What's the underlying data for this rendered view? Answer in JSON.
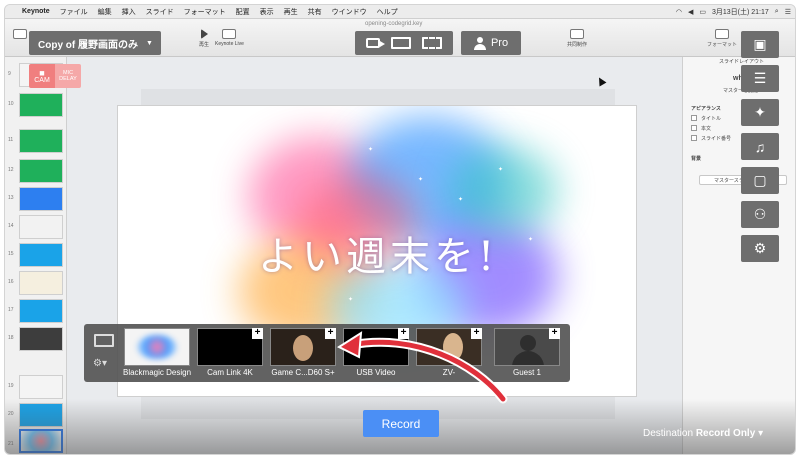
{
  "menubar": {
    "app_name": "Keynote",
    "items": [
      "ファイル",
      "編集",
      "挿入",
      "スライド",
      "フォーマット",
      "配置",
      "表示",
      "再生",
      "共有",
      "ウインドウ",
      "ヘルプ"
    ],
    "date_time": "3月13日(土)  21:17"
  },
  "toolbar": {
    "document_name": "opening-codegrid.key",
    "play_label": "再生",
    "keynote_live_label": "Keynote Live",
    "collaborate_label": "共同制作",
    "format_label": "フォーマット",
    "document_tab_label": "書類"
  },
  "overlay": {
    "presentation_chip": "Copy of 履野画面のみ",
    "cam_label": "CAM",
    "mic_label_1": "MIC",
    "mic_label_2": "DELAY",
    "pro_label": "Pro"
  },
  "slide": {
    "text": "よい週末を!"
  },
  "inspector": {
    "layout_label": "スライドレイアウト",
    "master_name": "white",
    "master_change": "マスターを変更",
    "appearance_label": "アピアランス",
    "title_option": "タイトル",
    "body_option": "本文",
    "slide_number_option": "スライド番号",
    "background_label": "背景",
    "edit_master_button": "マスタースライドを編集"
  },
  "sources": [
    {
      "label": "Blackmagic Design"
    },
    {
      "label": "Cam Link 4K"
    },
    {
      "label": "Game C...D60 S+"
    },
    {
      "label": "USB Video"
    },
    {
      "label": "ZV-"
    },
    {
      "label": "Guest 1"
    }
  ],
  "record_label": "Record",
  "destination": {
    "prefix": "Destination",
    "value": "Record Only"
  },
  "navigator": {
    "slide_numbers": [
      "9",
      "10",
      "11",
      "12",
      "13",
      "14",
      "15",
      "16",
      "17",
      "18",
      "19",
      "20",
      "21"
    ]
  },
  "colors": {
    "record_blue": "#4b8ff5",
    "chip_gray": "#6e6e6e",
    "cam_red": "#f07f7f",
    "arrow_red": "#e0303b"
  }
}
